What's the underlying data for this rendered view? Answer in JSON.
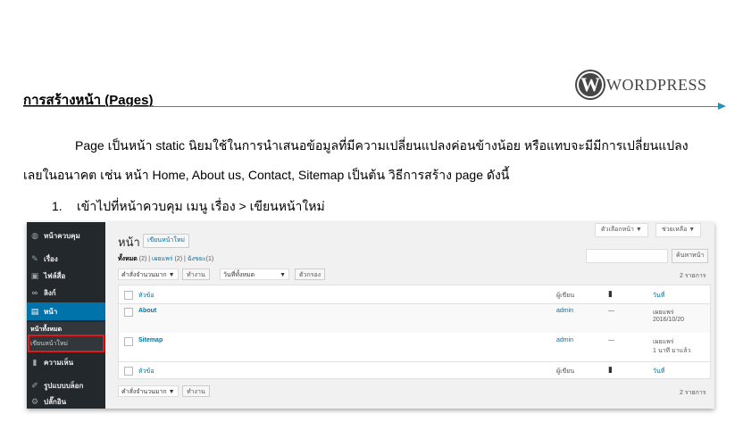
{
  "doc": {
    "title": "การสร้างหน้า (Pages)",
    "logo_text": "WORDPRESS",
    "logo_mark": "W",
    "para_line1": "Page เป็นหน้า static นิยมใช้ในการนำเสนอข้อมูลที่มีความเปลี่ยนแปลงค่อนข้างน้อย หรือแทบจะมีมีการเปลี่ยนแปลง",
    "para_line2": "เลยในอนาคต เช่น หน้า Home, About us, Contact, Sitemap เป็นต้น วิธีการสร้าง page ดังนี้",
    "step_num": "1.",
    "step_text": "เข้าไปที่หน้าควบคุม  เมนู เรื่อง > เขียนหน้าใหม่"
  },
  "colors": {
    "accent": "#2e8fb5",
    "sidebar_bg": "#23282d",
    "active": "#0073aa",
    "highlight": "#e0191a"
  },
  "screenshot": {
    "sidebar": {
      "items": [
        {
          "label": "หน้าควบคุม",
          "icon": "dashboard-icon"
        },
        {
          "label": "เรื่อง",
          "icon": "pin-icon"
        },
        {
          "label": "ไฟล์สื่อ",
          "icon": "media-icon"
        },
        {
          "label": "ลิงก์",
          "icon": "link-icon"
        },
        {
          "label": "หน้า",
          "icon": "page-icon"
        },
        {
          "label": "ความเห็น",
          "icon": "comment-icon"
        },
        {
          "label": "รูปแบบบล็อก",
          "icon": "brush-icon"
        },
        {
          "label": "ปลั๊กอิน",
          "icon": "plugin-icon"
        }
      ],
      "sub_items": [
        "หน้าทั้งหมด",
        "เขียนหน้าใหม่"
      ]
    },
    "screen_options": "ตัวเลือกหน้า ▼",
    "help": "ช่วยเหลือ ▼",
    "page_heading": "หน้า",
    "add_new": "เขียนหน้าใหม่",
    "filters": {
      "all": "ทั้งหมด",
      "all_count": "(2)",
      "published": "เผยแพร่",
      "published_count": "(2)",
      "drafts": "ฉังขยะ",
      "drafts_count": "(1)"
    },
    "search_button": "ค้นหาหน้า",
    "bulk_action": "คำสั่งจำนวนมาก ▼",
    "apply": "ทำงาน",
    "date_filter": "วันที่ทั้งหมด",
    "date_arrow": "▼",
    "filter_button": "ตัวกรอง",
    "items_count": "2 รายการ",
    "columns": {
      "title": "หัวข้อ",
      "author": "ผู้เขียน",
      "date": "วันที่"
    },
    "rows": [
      {
        "title": "About",
        "author": "admin",
        "comments": "—",
        "status": "เผยแพร่",
        "date": "2016/10/20"
      },
      {
        "title": "Sitemap",
        "author": "admin",
        "comments": "—",
        "status": "เผยแพร่",
        "date": "1 นาที มาแล้ว"
      }
    ]
  }
}
